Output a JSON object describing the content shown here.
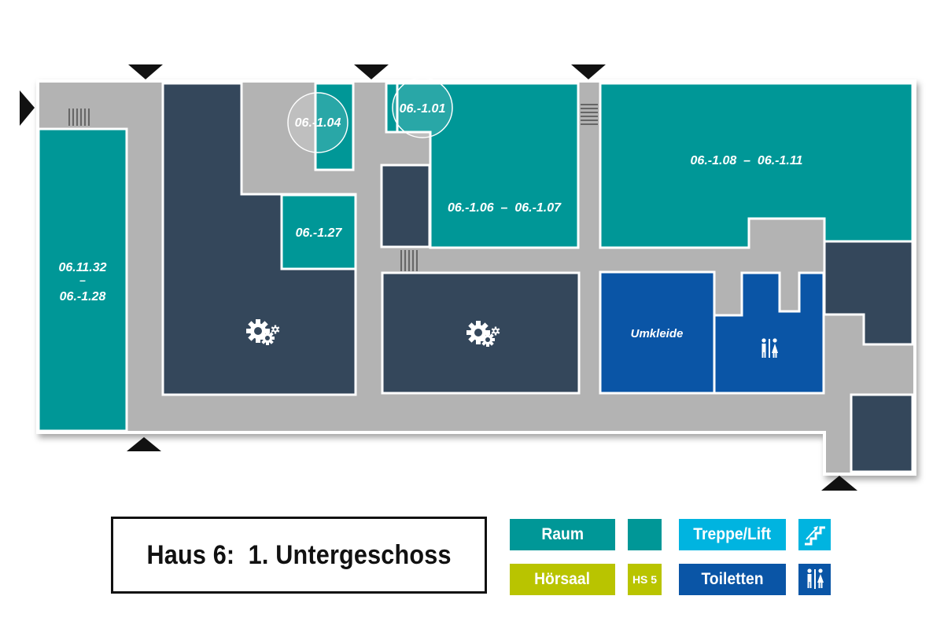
{
  "colors": {
    "corridor": "#b3b3b3",
    "room": "#009797",
    "tech": "#34475b",
    "toilet": "#0a55a6",
    "stairs": "#00b4e0",
    "lecture_hall": "#b9c400",
    "outline": "#ffffff",
    "marker": "#111111"
  },
  "rooms": {
    "r1": "06.11.32",
    "r1_dash": "–",
    "r1b": "06.-1.28",
    "r2": "06.-1.04",
    "r3": "06.-1.01",
    "r4": "06.-1.27",
    "r5": "06.-1.06  –  06.-1.07",
    "r6": "06.-1.08  –  06.-1.11",
    "changing": "Umkleide"
  },
  "icons": {
    "machine_room_1": "gears-icon",
    "machine_room_2": "gears-icon",
    "toilet": "toilet-icon",
    "entrances": "entrance-triangle-icon",
    "stairs_marks": "stairs-hatch-icon"
  },
  "legend": {
    "title": "Haus 6:  1. Untergeschoss",
    "room_label": "Raum",
    "stairs_label": "Treppe/Lift",
    "hall_label": "Hörsaal",
    "hall_swatch_label": "HS 5",
    "toilet_label": "Toiletten"
  }
}
